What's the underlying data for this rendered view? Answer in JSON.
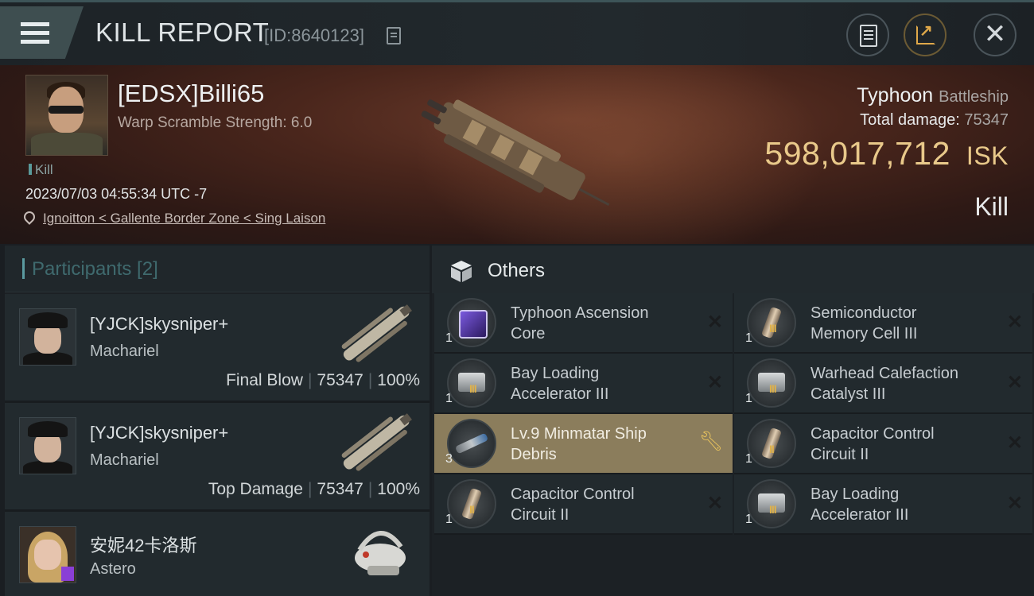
{
  "header": {
    "title": "KILL REPORT",
    "report_id": "[ID:8640123]"
  },
  "victim": {
    "name": "[EDSX]Billi65",
    "warp_scramble": "Warp Scramble Strength: 6.0",
    "tag": "Kill",
    "datetime": "2023/07/03 04:55:34 UTC -7",
    "location": "Ignoitton < Gallente Border Zone < Sing Laison",
    "ship_name": "Typhoon",
    "ship_class": "Battleship",
    "total_damage_label": "Total damage:",
    "total_damage": "75347",
    "isk_value": "598,017,712",
    "isk_unit": "ISK",
    "result": "Kill"
  },
  "participants": {
    "title": "Participants [2]",
    "rows": [
      {
        "name": "[YJCK]skysniper+",
        "ship": "Machariel",
        "role": "Final Blow",
        "damage": "75347",
        "percent": "100%"
      },
      {
        "name": "[YJCK]skysniper+",
        "ship": "Machariel",
        "role": "Top Damage",
        "damage": "75347",
        "percent": "100%"
      },
      {
        "name": "安妮42卡洛斯",
        "ship": "Astero"
      }
    ]
  },
  "others": {
    "title": "Others",
    "items": [
      {
        "name": "Typhoon Ascension Core",
        "qty": "1",
        "tier": "",
        "icon": "ascension-core"
      },
      {
        "name": "Semiconductor Memory Cell III",
        "qty": "1",
        "tier": "III",
        "icon": "memory-cell"
      },
      {
        "name": "Bay Loading Accelerator III",
        "qty": "1",
        "tier": "III",
        "icon": "launcher-module"
      },
      {
        "name": "Warhead Calefaction Catalyst III",
        "qty": "1",
        "tier": "III",
        "icon": "launcher-module"
      },
      {
        "name": "Lv.9 Minmatar Ship Debris",
        "qty": "3",
        "tier": "",
        "icon": "ship-debris",
        "highlighted": true
      },
      {
        "name": "Capacitor Control Circuit II",
        "qty": "1",
        "tier": "II",
        "icon": "memory-cell"
      },
      {
        "name": "Capacitor Control Circuit II",
        "qty": "1",
        "tier": "II",
        "icon": "memory-cell"
      },
      {
        "name": "Bay Loading Accelerator III",
        "qty": "1",
        "tier": "III",
        "icon": "launcher-module"
      }
    ]
  },
  "colors": {
    "isk": "#e9c98a",
    "highlight_row": "#8b7d5c",
    "tier_mark": "#e0b24a",
    "participants_accent": "#5a9aa0"
  }
}
